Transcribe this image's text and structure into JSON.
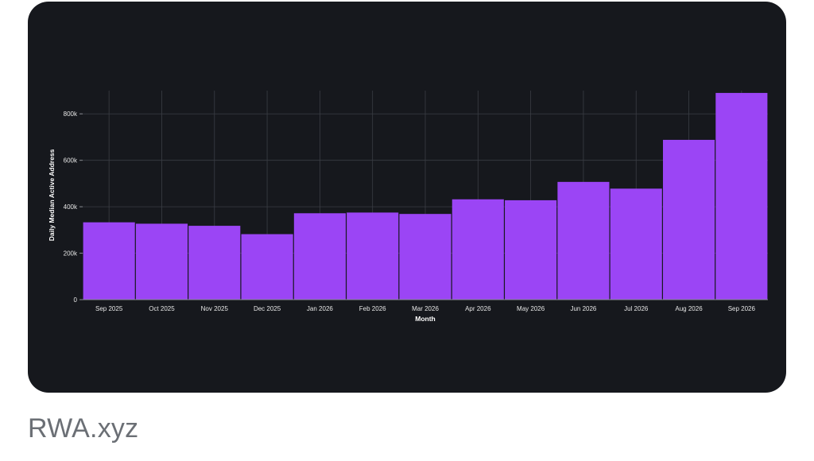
{
  "chart_data": {
    "type": "bar",
    "title": "",
    "xlabel": "Month",
    "ylabel": "Daily Median Active Address",
    "categories": [
      "Sep 2025",
      "Oct 2025",
      "Nov 2025",
      "Dec 2025",
      "Jan 2026",
      "Feb 2026",
      "Mar 2026",
      "Apr 2026",
      "May 2026",
      "Jun 2026",
      "Jul 2026",
      "Aug 2026",
      "Sep 2026"
    ],
    "values": [
      333000,
      327000,
      318000,
      282000,
      372000,
      375000,
      369000,
      432000,
      428000,
      507000,
      478000,
      688000,
      890000
    ],
    "yticks": [
      0,
      200000,
      400000,
      600000,
      800000
    ],
    "ytick_labels": [
      "0",
      "200k",
      "400k",
      "600k",
      "800k"
    ],
    "ylim": [
      0,
      900000
    ],
    "grid": true,
    "colors": {
      "bar": "#9b45f5",
      "background": "#16181d",
      "grid": "#3a3d44"
    }
  },
  "source": {
    "label": "RWA.xyz"
  }
}
